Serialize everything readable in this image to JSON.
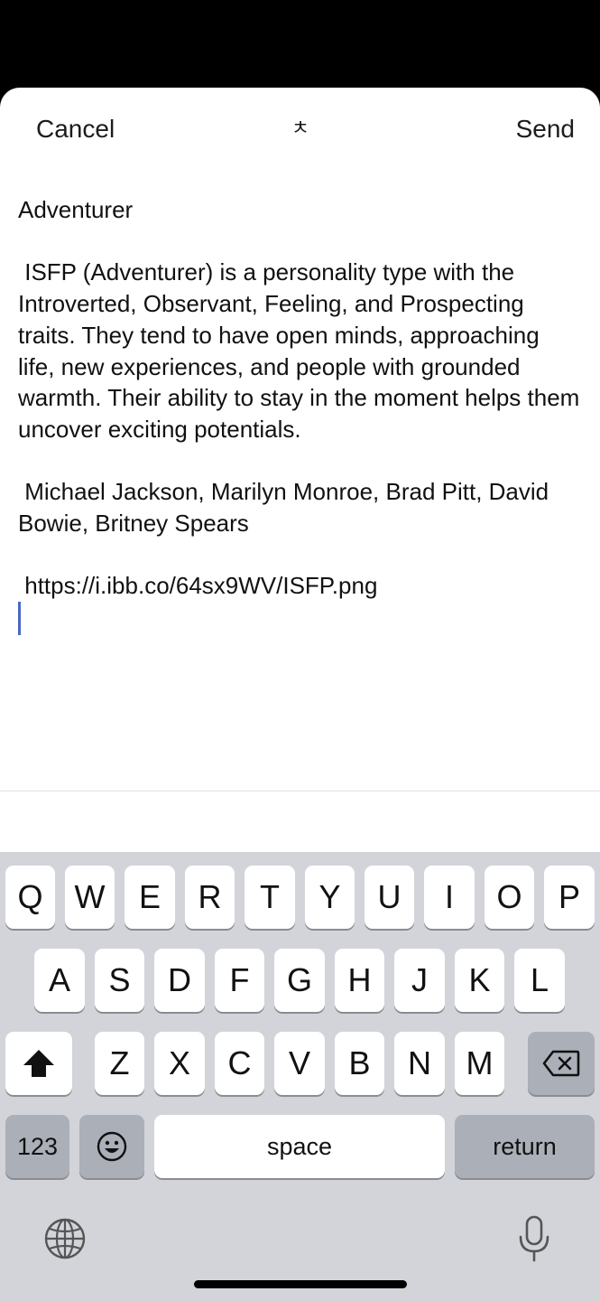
{
  "nav": {
    "cancel_label": "Cancel",
    "center_icon": "ㅊ",
    "send_label": "Send"
  },
  "message": {
    "title": "Adventurer",
    "description": " ISFP (Adventurer) is a personality type with the Introverted, Observant, Feeling, and Prospecting traits. They tend to have open minds, approaching life, new experiences, and people with grounded warmth. Their ability to stay in the moment helps them uncover exciting potentials.",
    "people": " Michael Jackson, Marilyn Monroe, Brad Pitt, David Bowie, Britney Spears",
    "link": " https://i.ibb.co/64sx9WV/ISFP.png"
  },
  "keyboard": {
    "row1": [
      "Q",
      "W",
      "E",
      "R",
      "T",
      "Y",
      "U",
      "I",
      "O",
      "P"
    ],
    "row2": [
      "A",
      "S",
      "D",
      "F",
      "G",
      "H",
      "J",
      "K",
      "L"
    ],
    "row3": [
      "Z",
      "X",
      "C",
      "V",
      "B",
      "N",
      "M"
    ],
    "numbers_label": "123",
    "space_label": "space",
    "return_label": "return",
    "icons": {
      "shift": "shift-icon",
      "delete": "delete-icon",
      "emoji": "emoji-icon",
      "globe": "globe-icon",
      "mic": "microphone-icon"
    }
  }
}
